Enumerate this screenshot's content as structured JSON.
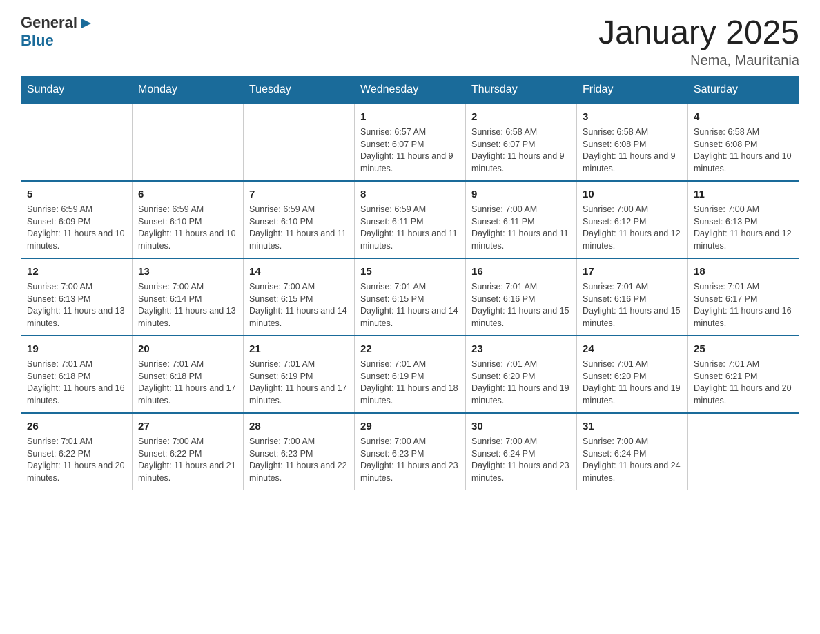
{
  "logo": {
    "general": "General",
    "blue": "Blue",
    "arrow": "▶"
  },
  "title": "January 2025",
  "subtitle": "Nema, Mauritania",
  "headers": [
    "Sunday",
    "Monday",
    "Tuesday",
    "Wednesday",
    "Thursday",
    "Friday",
    "Saturday"
  ],
  "weeks": [
    [
      {
        "day": "",
        "info": ""
      },
      {
        "day": "",
        "info": ""
      },
      {
        "day": "",
        "info": ""
      },
      {
        "day": "1",
        "info": "Sunrise: 6:57 AM\nSunset: 6:07 PM\nDaylight: 11 hours and 9 minutes."
      },
      {
        "day": "2",
        "info": "Sunrise: 6:58 AM\nSunset: 6:07 PM\nDaylight: 11 hours and 9 minutes."
      },
      {
        "day": "3",
        "info": "Sunrise: 6:58 AM\nSunset: 6:08 PM\nDaylight: 11 hours and 9 minutes."
      },
      {
        "day": "4",
        "info": "Sunrise: 6:58 AM\nSunset: 6:08 PM\nDaylight: 11 hours and 10 minutes."
      }
    ],
    [
      {
        "day": "5",
        "info": "Sunrise: 6:59 AM\nSunset: 6:09 PM\nDaylight: 11 hours and 10 minutes."
      },
      {
        "day": "6",
        "info": "Sunrise: 6:59 AM\nSunset: 6:10 PM\nDaylight: 11 hours and 10 minutes."
      },
      {
        "day": "7",
        "info": "Sunrise: 6:59 AM\nSunset: 6:10 PM\nDaylight: 11 hours and 11 minutes."
      },
      {
        "day": "8",
        "info": "Sunrise: 6:59 AM\nSunset: 6:11 PM\nDaylight: 11 hours and 11 minutes."
      },
      {
        "day": "9",
        "info": "Sunrise: 7:00 AM\nSunset: 6:11 PM\nDaylight: 11 hours and 11 minutes."
      },
      {
        "day": "10",
        "info": "Sunrise: 7:00 AM\nSunset: 6:12 PM\nDaylight: 11 hours and 12 minutes."
      },
      {
        "day": "11",
        "info": "Sunrise: 7:00 AM\nSunset: 6:13 PM\nDaylight: 11 hours and 12 minutes."
      }
    ],
    [
      {
        "day": "12",
        "info": "Sunrise: 7:00 AM\nSunset: 6:13 PM\nDaylight: 11 hours and 13 minutes."
      },
      {
        "day": "13",
        "info": "Sunrise: 7:00 AM\nSunset: 6:14 PM\nDaylight: 11 hours and 13 minutes."
      },
      {
        "day": "14",
        "info": "Sunrise: 7:00 AM\nSunset: 6:15 PM\nDaylight: 11 hours and 14 minutes."
      },
      {
        "day": "15",
        "info": "Sunrise: 7:01 AM\nSunset: 6:15 PM\nDaylight: 11 hours and 14 minutes."
      },
      {
        "day": "16",
        "info": "Sunrise: 7:01 AM\nSunset: 6:16 PM\nDaylight: 11 hours and 15 minutes."
      },
      {
        "day": "17",
        "info": "Sunrise: 7:01 AM\nSunset: 6:16 PM\nDaylight: 11 hours and 15 minutes."
      },
      {
        "day": "18",
        "info": "Sunrise: 7:01 AM\nSunset: 6:17 PM\nDaylight: 11 hours and 16 minutes."
      }
    ],
    [
      {
        "day": "19",
        "info": "Sunrise: 7:01 AM\nSunset: 6:18 PM\nDaylight: 11 hours and 16 minutes."
      },
      {
        "day": "20",
        "info": "Sunrise: 7:01 AM\nSunset: 6:18 PM\nDaylight: 11 hours and 17 minutes."
      },
      {
        "day": "21",
        "info": "Sunrise: 7:01 AM\nSunset: 6:19 PM\nDaylight: 11 hours and 17 minutes."
      },
      {
        "day": "22",
        "info": "Sunrise: 7:01 AM\nSunset: 6:19 PM\nDaylight: 11 hours and 18 minutes."
      },
      {
        "day": "23",
        "info": "Sunrise: 7:01 AM\nSunset: 6:20 PM\nDaylight: 11 hours and 19 minutes."
      },
      {
        "day": "24",
        "info": "Sunrise: 7:01 AM\nSunset: 6:20 PM\nDaylight: 11 hours and 19 minutes."
      },
      {
        "day": "25",
        "info": "Sunrise: 7:01 AM\nSunset: 6:21 PM\nDaylight: 11 hours and 20 minutes."
      }
    ],
    [
      {
        "day": "26",
        "info": "Sunrise: 7:01 AM\nSunset: 6:22 PM\nDaylight: 11 hours and 20 minutes."
      },
      {
        "day": "27",
        "info": "Sunrise: 7:00 AM\nSunset: 6:22 PM\nDaylight: 11 hours and 21 minutes."
      },
      {
        "day": "28",
        "info": "Sunrise: 7:00 AM\nSunset: 6:23 PM\nDaylight: 11 hours and 22 minutes."
      },
      {
        "day": "29",
        "info": "Sunrise: 7:00 AM\nSunset: 6:23 PM\nDaylight: 11 hours and 23 minutes."
      },
      {
        "day": "30",
        "info": "Sunrise: 7:00 AM\nSunset: 6:24 PM\nDaylight: 11 hours and 23 minutes."
      },
      {
        "day": "31",
        "info": "Sunrise: 7:00 AM\nSunset: 6:24 PM\nDaylight: 11 hours and 24 minutes."
      },
      {
        "day": "",
        "info": ""
      }
    ]
  ]
}
